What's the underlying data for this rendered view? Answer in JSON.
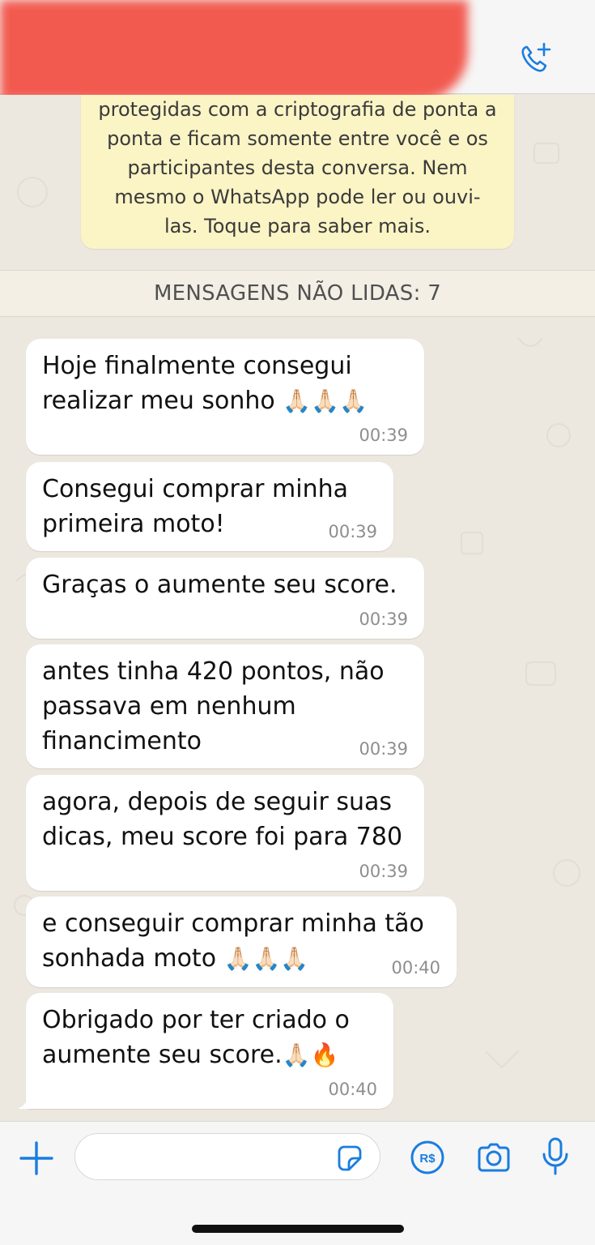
{
  "header": {
    "contact_name_redacted": true,
    "call_icon": "phone-plus-icon"
  },
  "encryption_notice": {
    "lines": [
      "protegidas com a criptografia de ponta a",
      "ponta e ficam somente entre você e os",
      "participantes desta conversa. Nem",
      "mesmo o WhatsApp pode ler ou ouvi-",
      "las. Toque para saber mais."
    ]
  },
  "unread_divider": "MENSAGENS NÃO LIDAS: 7",
  "messages": [
    {
      "lines": [
        "Hoje finalmente consegui",
        "realizar meu sonho"
      ],
      "emoji": "🙏🏻🙏🏻🙏🏻",
      "time": "00:39"
    },
    {
      "lines": [
        "Consegui comprar minha",
        "primeira moto!"
      ],
      "time": "00:39"
    },
    {
      "lines": [
        "Graças o aumente seu score."
      ],
      "time": "00:39"
    },
    {
      "lines": [
        "antes tinha 420 pontos, não",
        "passava em nenhum",
        "financimento"
      ],
      "time": "00:39"
    },
    {
      "lines": [
        "agora, depois de seguir suas",
        "dicas, meu score foi para 780"
      ],
      "time": "00:39"
    },
    {
      "lines": [
        "e conseguir comprar minha tão",
        "sonhada moto"
      ],
      "emoji": "🙏🏻🙏🏻🙏🏻",
      "time": "00:40"
    },
    {
      "lines": [
        "Obrigado por ter criado o",
        "aumente seu score."
      ],
      "emoji": "🙏🏻🔥",
      "time": "00:40"
    }
  ],
  "composer": {
    "placeholder": "",
    "icons": [
      "plus-icon",
      "sticker-icon",
      "payment-icon",
      "camera-icon",
      "microphone-icon"
    ]
  },
  "colors": {
    "accent": "#1a7de0",
    "chat_background": "#ece7df",
    "bubble": "#ffffff",
    "notice": "#fbf4c5"
  }
}
